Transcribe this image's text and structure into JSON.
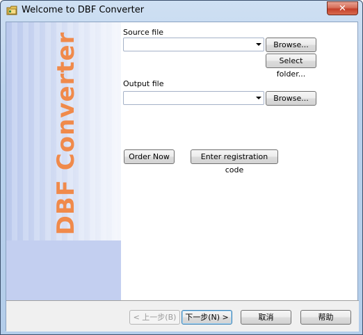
{
  "window": {
    "title": "Welcome to DBF Converter",
    "close_symbol": "✕",
    "icon": "folder-app-icon"
  },
  "side_panel": {
    "brand_text": "DBF Converter",
    "brand_color": "#f08a4b"
  },
  "source": {
    "label": "Source file",
    "value": "",
    "browse_label": "Browse...",
    "select_folder_label": "Select folder..."
  },
  "output": {
    "label": "Output file",
    "value": "",
    "browse_label": "Browse..."
  },
  "actions": {
    "order_now_label": "Order Now",
    "registration_label": "Enter registration code"
  },
  "footer": {
    "back_label": "< 上一步(B)",
    "next_label": "下一步(N) >",
    "cancel_label": "取消",
    "help_label": "帮助"
  }
}
